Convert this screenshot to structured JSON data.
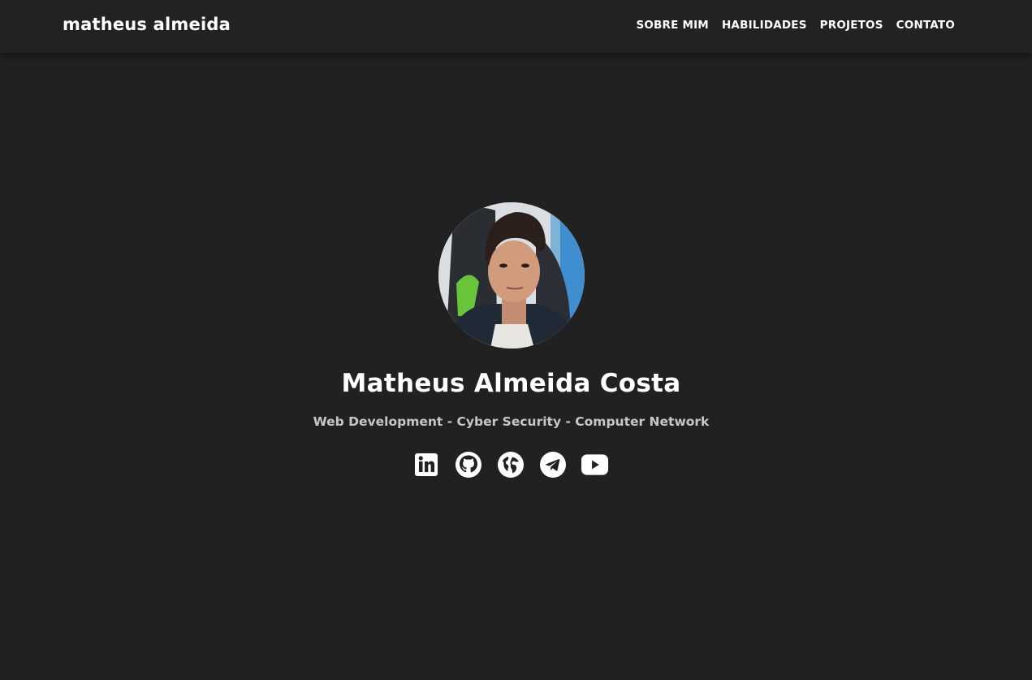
{
  "navbar": {
    "brand": "matheus almeida",
    "links": [
      {
        "label": "SOBRE MIM"
      },
      {
        "label": "HABILIDADES"
      },
      {
        "label": "PROJETOS"
      },
      {
        "label": "CONTATO"
      }
    ]
  },
  "hero": {
    "name": "Matheus Almeida Costa",
    "subtitle": "Web Development - Cyber Security - Computer Network",
    "socials": [
      {
        "icon": "linkedin-icon"
      },
      {
        "icon": "github-icon"
      },
      {
        "icon": "globe-icon"
      },
      {
        "icon": "telegram-icon"
      },
      {
        "icon": "youtube-icon"
      }
    ]
  },
  "colors": {
    "background": "#212121",
    "navbar": "#222222",
    "text": "#ffffff",
    "subtitle": "#c7c7c7"
  }
}
